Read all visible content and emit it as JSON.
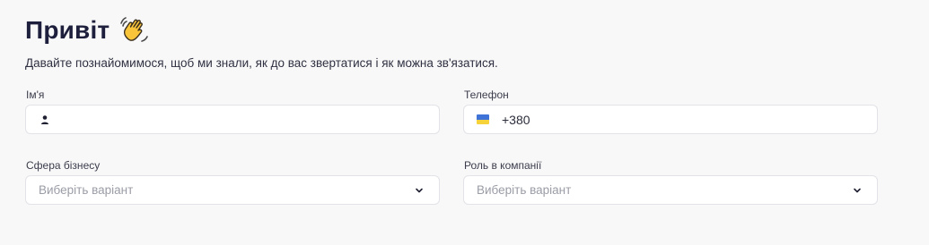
{
  "header": {
    "title": "Привіт",
    "subtitle": "Давайте познайомимося, щоб ми знали, як до вас звертатися і як можна зв'язатися."
  },
  "fields": {
    "name": {
      "label": "Ім'я",
      "value": ""
    },
    "phone": {
      "label": "Телефон",
      "value": "+380"
    },
    "business": {
      "label": "Сфера бізнесу",
      "placeholder": "Виберіть варіант"
    },
    "role": {
      "label": "Роль в компанії",
      "placeholder": "Виберіть варіант"
    }
  },
  "icons": {
    "title_emoji": "waving-hand-icon",
    "name_icon": "user-icon",
    "phone_icon": "ukraine-flag-icon",
    "select_icon": "chevron-down-icon"
  },
  "colors": {
    "background": "#f8f8f8",
    "title": "#1d1f3c",
    "input_border": "#e2e3e8",
    "placeholder": "#9a9ca6",
    "flag_blue": "#3f73d8",
    "flag_yellow": "#f6d33b"
  }
}
